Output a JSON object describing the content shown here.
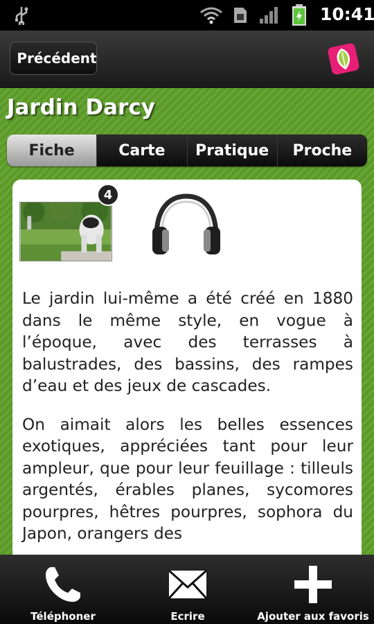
{
  "status_bar": {
    "time": "10:41"
  },
  "header": {
    "back_label": "Précédent"
  },
  "page": {
    "title": "Jardin Darcy"
  },
  "tabs": [
    {
      "label": "Fiche",
      "active": true
    },
    {
      "label": "Carte",
      "active": false
    },
    {
      "label": "Pratique",
      "active": false
    },
    {
      "label": "Proche",
      "active": false
    }
  ],
  "card": {
    "photo_count": "4",
    "paragraphs": [
      "Le jardin lui-même a été créé en 1880 dans le même style, en vogue à l’époque, avec des terrasses à balustrades, des bassins, des rampes d’eau et des jeux de cascades.",
      "On aimait alors les belles essences exotiques, appréciées tant pour leur ampleur, que pour leur feuillage : tilleuls argentés, érables planes, sycomores pourpres, hêtres pourpres, sophora du Japon, orangers des"
    ]
  },
  "bottom_bar": {
    "phone_label": "Téléphoner",
    "write_label": "Ecrire",
    "favorites_label": "Ajouter aux favoris"
  },
  "colors": {
    "accent_green": "#5a9a26",
    "logo_pink": "#e81f76"
  },
  "icons": [
    "usb-icon",
    "wifi-icon",
    "sim-icon",
    "signal-icon",
    "battery-icon",
    "leaf-logo-icon",
    "headphones-icon",
    "phone-icon",
    "envelope-icon",
    "plus-icon"
  ]
}
